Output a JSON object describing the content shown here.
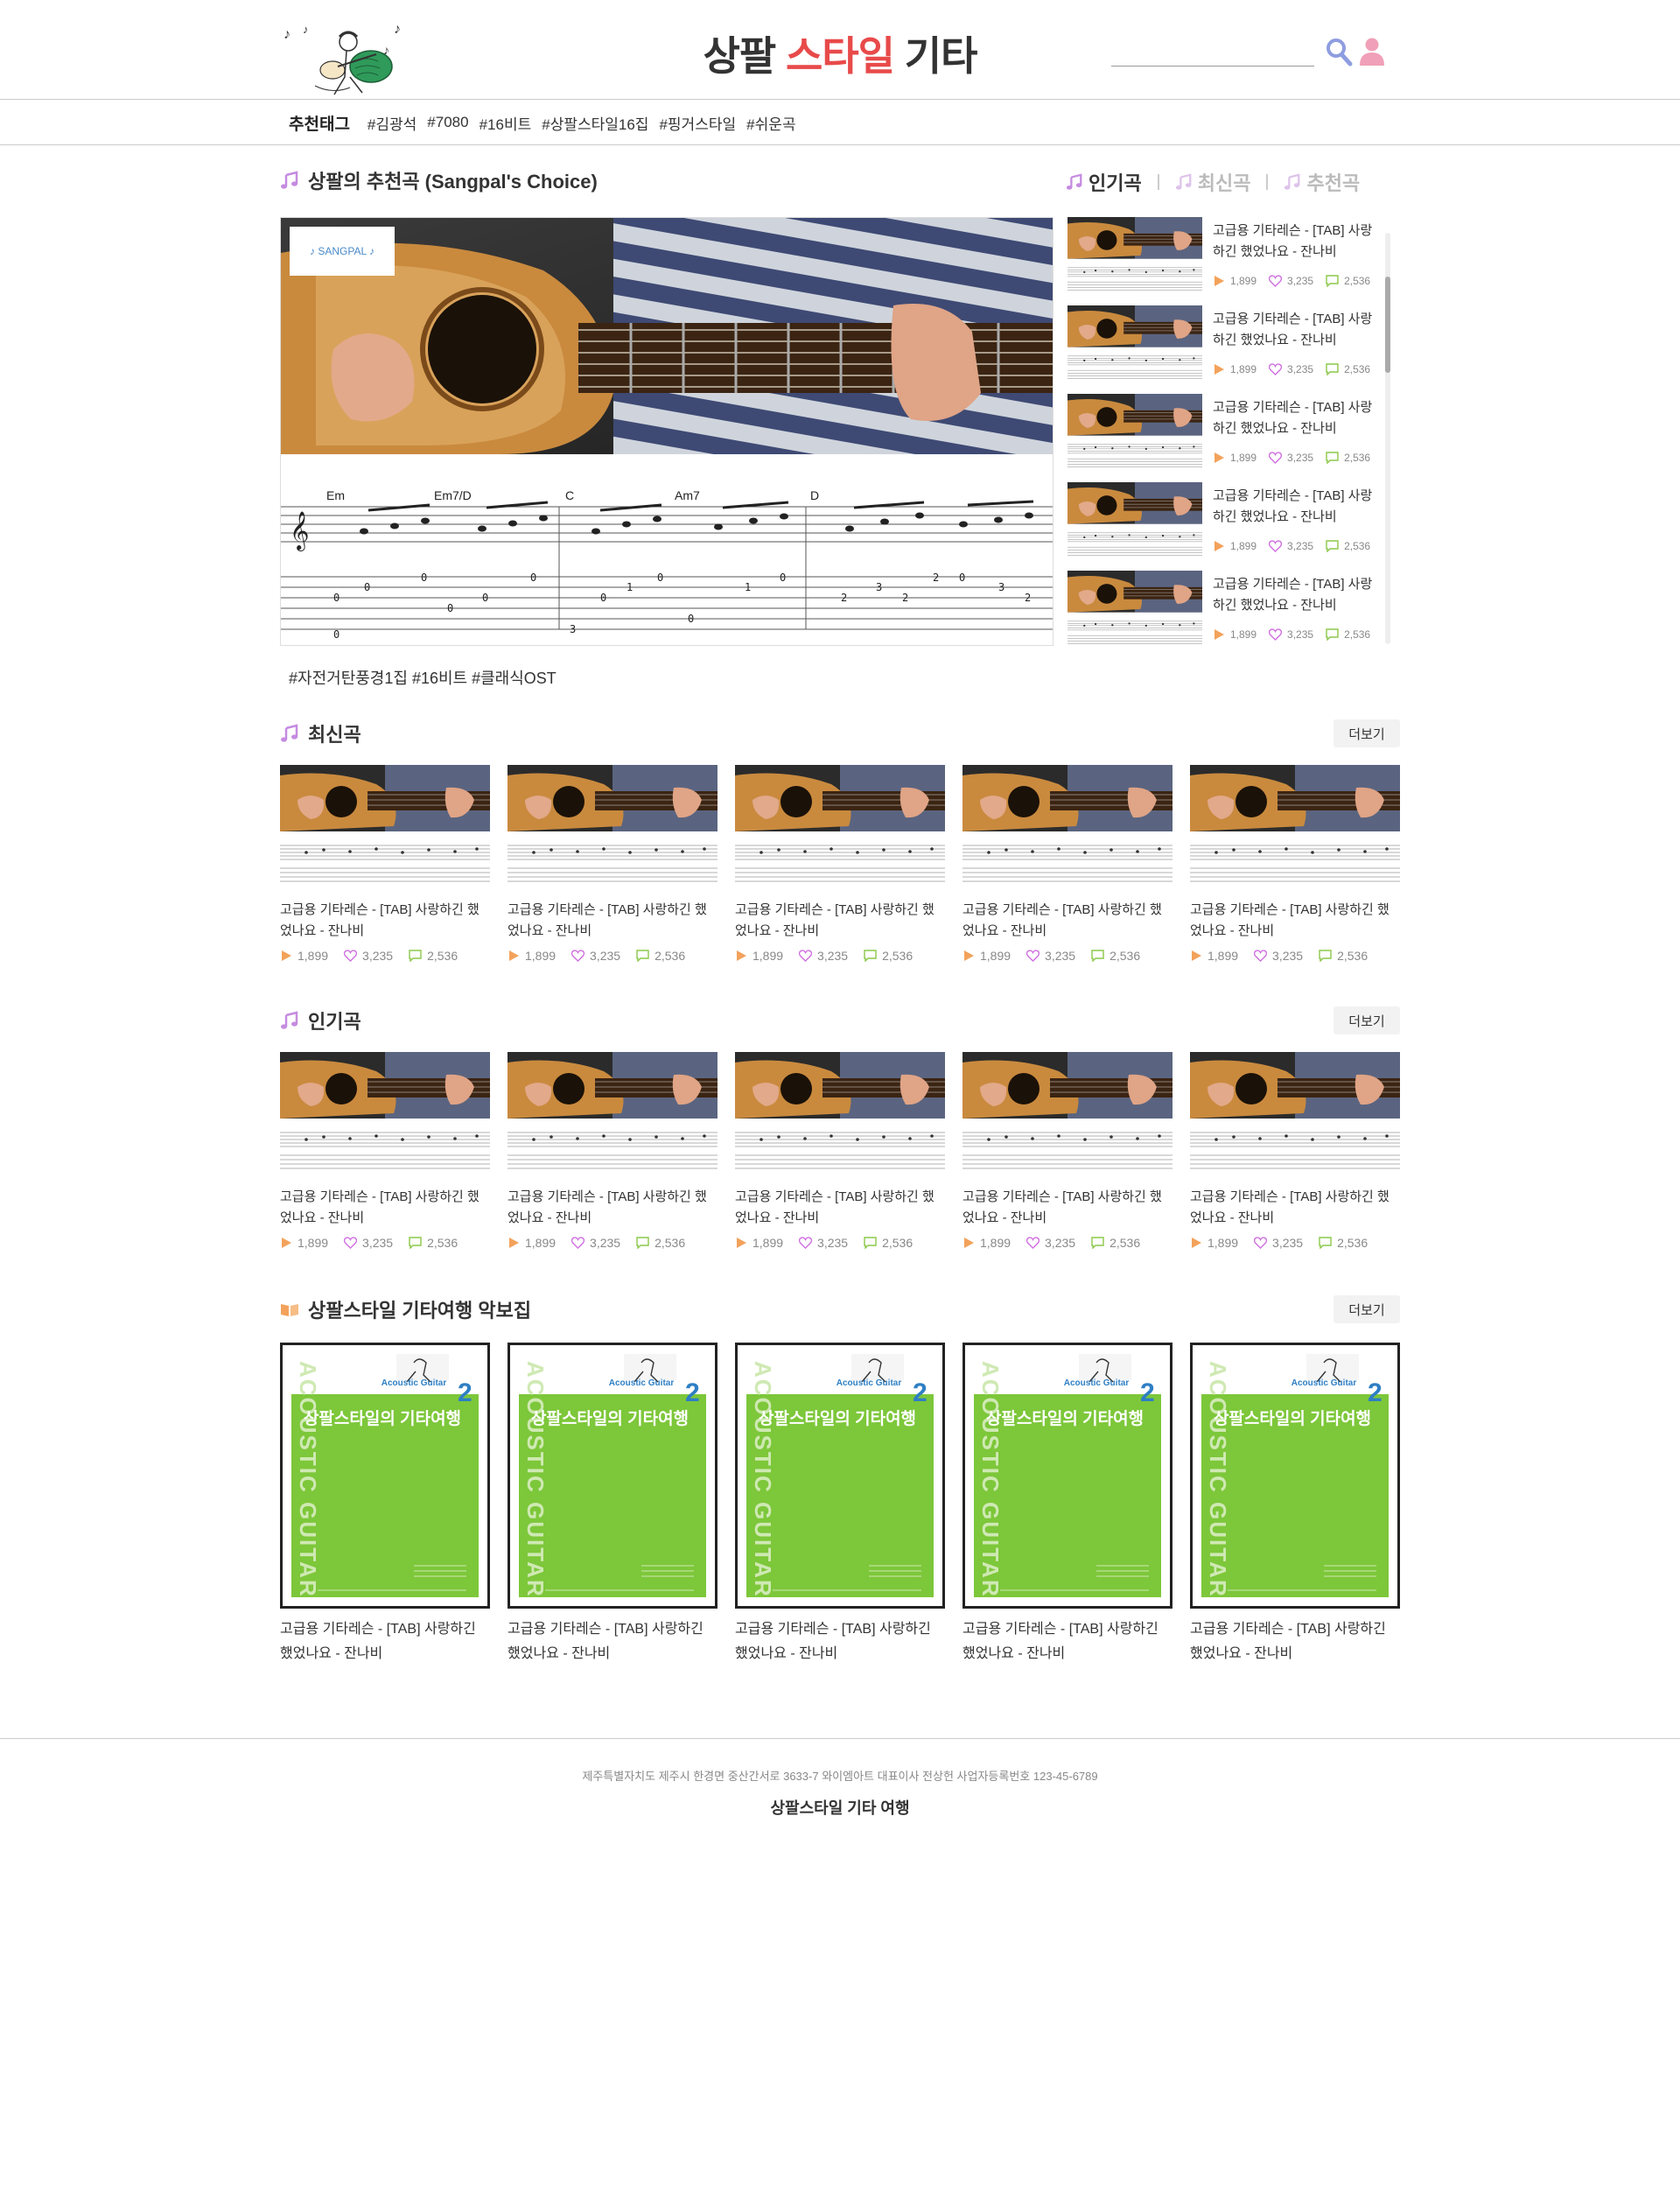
{
  "header": {
    "title_main": "상팔 ",
    "title_accent": "스타일",
    "title_end": " 기타",
    "search_placeholder": ""
  },
  "tagbar": {
    "title": "추천태그",
    "tags": [
      "#김광석",
      "#7080",
      "#16비트",
      "#상팔스타일16집",
      "#핑거스타일",
      "#쉬운곡"
    ]
  },
  "recommend": {
    "title": "상팔의 추천곡 (Sangpal's Choice)",
    "tags": "#자전거탄풍경1집 #16비트 #클래식OST",
    "tabs": [
      "인기곡",
      "최신곡",
      "추천곡"
    ],
    "list": [
      {
        "title": "고급용 기타레슨 - [TAB] 사랑하긴 했었나요 - 잔나비",
        "plays": "1,899",
        "likes": "3,235",
        "comments": "2,536"
      },
      {
        "title": "고급용 기타레슨 - [TAB] 사랑하긴 했었나요 - 잔나비",
        "plays": "1,899",
        "likes": "3,235",
        "comments": "2,536"
      },
      {
        "title": "고급용 기타레슨 - [TAB] 사랑하긴 했었나요 - 잔나비",
        "plays": "1,899",
        "likes": "3,235",
        "comments": "2,536"
      },
      {
        "title": "고급용 기타레슨 - [TAB] 사랑하긴 했었나요 - 잔나비",
        "plays": "1,899",
        "likes": "3,235",
        "comments": "2,536"
      },
      {
        "title": "고급용 기타레슨 - [TAB] 사랑하긴 했었나요 - 잔나비",
        "plays": "1,899",
        "likes": "3,235",
        "comments": "2,536"
      }
    ],
    "chords": [
      "Em",
      "Em7/D",
      "C",
      "Am7",
      "D"
    ]
  },
  "latest": {
    "title": "최신곡",
    "more": "더보기",
    "cards": [
      {
        "title": "고급용 기타레슨 - [TAB] 사랑하긴 했었나요 - 잔나비",
        "plays": "1,899",
        "likes": "3,235",
        "comments": "2,536"
      },
      {
        "title": "고급용 기타레슨 - [TAB] 사랑하긴 했었나요 - 잔나비",
        "plays": "1,899",
        "likes": "3,235",
        "comments": "2,536"
      },
      {
        "title": "고급용 기타레슨 - [TAB] 사랑하긴 했었나요 - 잔나비",
        "plays": "1,899",
        "likes": "3,235",
        "comments": "2,536"
      },
      {
        "title": "고급용 기타레슨 - [TAB] 사랑하긴 했었나요 - 잔나비",
        "plays": "1,899",
        "likes": "3,235",
        "comments": "2,536"
      },
      {
        "title": "고급용 기타레슨 - [TAB] 사랑하긴 했었나요 - 잔나비",
        "plays": "1,899",
        "likes": "3,235",
        "comments": "2,536"
      }
    ]
  },
  "popular": {
    "title": "인기곡",
    "more": "더보기",
    "cards": [
      {
        "title": "고급용 기타레슨 - [TAB] 사랑하긴 했었나요 - 잔나비",
        "plays": "1,899",
        "likes": "3,235",
        "comments": "2,536"
      },
      {
        "title": "고급용 기타레슨 - [TAB] 사랑하긴 했었나요 - 잔나비",
        "plays": "1,899",
        "likes": "3,235",
        "comments": "2,536"
      },
      {
        "title": "고급용 기타레슨 - [TAB] 사랑하긴 했었나요 - 잔나비",
        "plays": "1,899",
        "likes": "3,235",
        "comments": "2,536"
      },
      {
        "title": "고급용 기타레슨 - [TAB] 사랑하긴 했었나요 - 잔나비",
        "plays": "1,899",
        "likes": "3,235",
        "comments": "2,536"
      },
      {
        "title": "고급용 기타레슨 - [TAB] 사랑하긴 했었나요 - 잔나비",
        "plays": "1,899",
        "likes": "3,235",
        "comments": "2,536"
      }
    ]
  },
  "books": {
    "title": "상팔스타일 기타여행 악보집",
    "more": "더보기",
    "cover_side_text": "ACOUSTIC GUITAR",
    "cover_title": "상팔스타일의 기타여행",
    "cover_number": "2",
    "cover_logo": "Acoustic Guitar",
    "items": [
      {
        "title": "고급용 기타레슨 - [TAB] 사랑하긴 했었나요 - 잔나비"
      },
      {
        "title": "고급용 기타레슨 - [TAB] 사랑하긴 했었나요 - 잔나비"
      },
      {
        "title": "고급용 기타레슨 - [TAB] 사랑하긴 했었나요 - 잔나비"
      },
      {
        "title": "고급용 기타레슨 - [TAB] 사랑하긴 했었나요 - 잔나비"
      },
      {
        "title": "고급용 기타레슨 - [TAB] 사랑하긴 했었나요 - 잔나비"
      }
    ]
  },
  "footer": {
    "address": "제주특별자치도 제주시 한경면 중산간서로 3633-7 와이엠아트 대표이사 전상헌 사업자등록번호 123-45-6789",
    "name": "상팔스타일 기타 여행"
  },
  "colors": {
    "accent": "#e84a4a",
    "note_icon": "#c58be0",
    "search_icon": "#8e9de0",
    "user_icon": "#f0a0b8",
    "play_icon": "#f3a25b",
    "like_icon": "#d070e0",
    "comment_icon": "#8bc84a",
    "book_green": "#7dc73a"
  }
}
